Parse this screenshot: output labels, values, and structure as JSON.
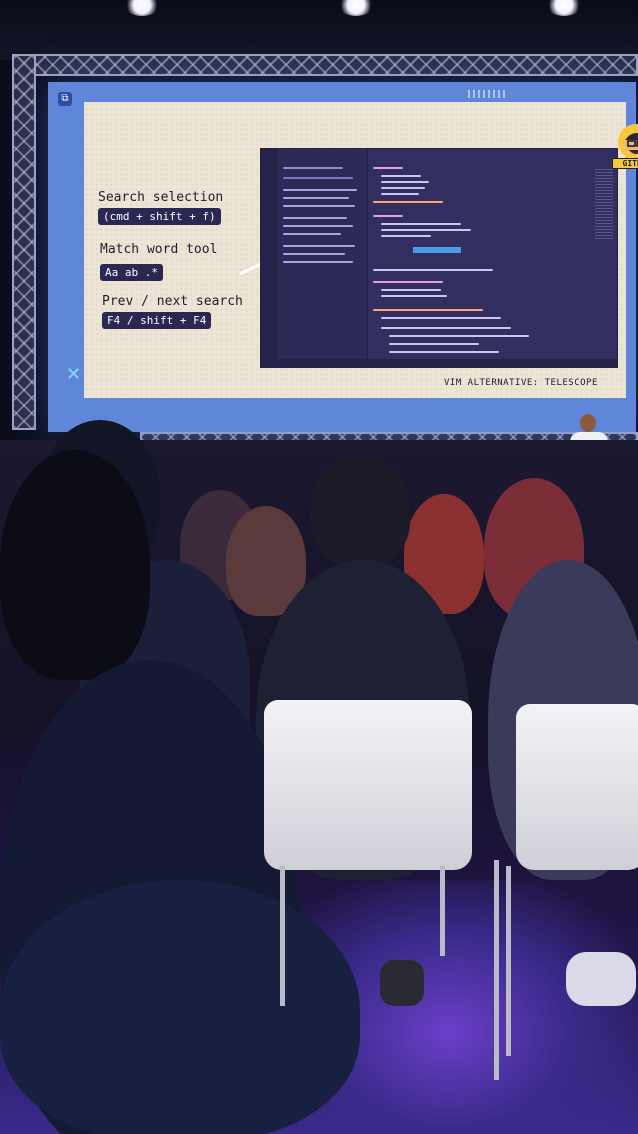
{
  "slide": {
    "search_selection_label": "Search selection",
    "search_selection_keys": "(cmd + shift + f)",
    "match_word_label": "Match word tool",
    "match_word_icons": "Aa ab .*",
    "prev_next_label": "Prev / next search",
    "prev_next_keys": "F4 / shift + F4",
    "footer": "VIM ALTERNATIVE: TELESCOPE",
    "badge_name": "GITBAR"
  },
  "colors": {
    "screen_frame": "#5f86d8",
    "slide_paper": "#ece5d6",
    "key_chip": "#2a2752",
    "editor_bg": "#332e60",
    "search_highlight": "#4c9be8",
    "badge": "#f7c83a",
    "floor_glow": "#6a3fc8"
  },
  "icons": [
    "gitbar-avatar-icon",
    "arrow-icon",
    "close-x-icon"
  ]
}
